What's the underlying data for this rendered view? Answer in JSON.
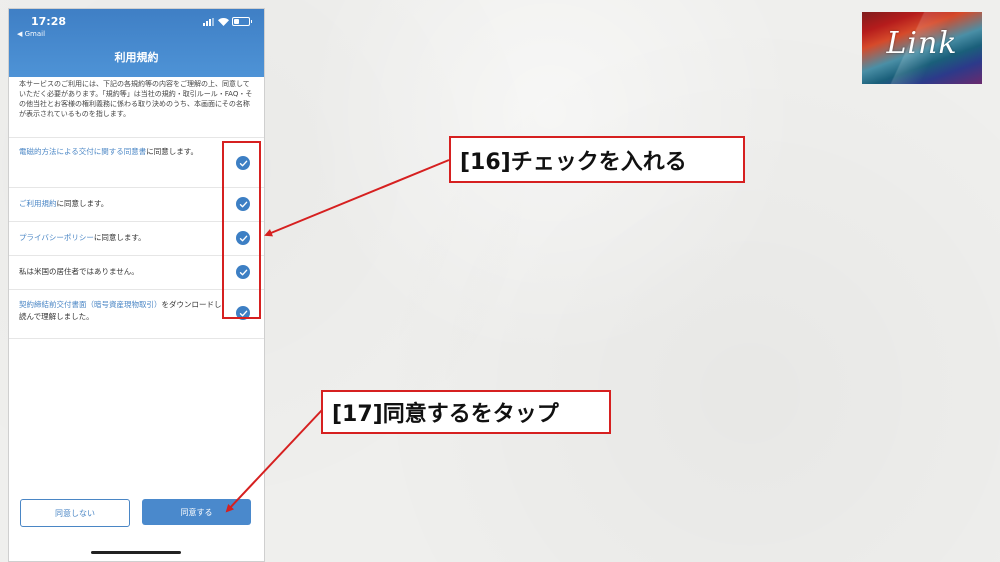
{
  "status_bar": {
    "time": "17:28",
    "back_app": "◀ Gmail"
  },
  "screen": {
    "title": "利用規約"
  },
  "intro": "本サービスのご利用には、下記の各規約等の内容をご理解の上、同意していただく必要があります。「規約等」は当社の規約・取引ルール・FAQ・その他当社とお客様の権利義務に係わる取り決めのうち、本画面にその名称が表示されているものを指します。",
  "agreements": [
    {
      "link": "電磁的方法による交付に関する同意書",
      "text": "に同意します。"
    },
    {
      "link": "ご利用規約",
      "text": "に同意します。"
    },
    {
      "link": "プライバシーポリシー",
      "text": "に同意します。"
    },
    {
      "link": "",
      "text": "私は米国の居住者ではありません。"
    },
    {
      "link": "契約締結前交付書面（暗号資産現物取引）",
      "text": "をダウンロードし読んで理解しました。"
    }
  ],
  "buttons": {
    "decline": "同意しない",
    "agree": "同意する"
  },
  "annotations": {
    "step16": "[16]チェックを入れる",
    "step17": "[17]同意するをタップ"
  },
  "logo": {
    "text": "Link"
  },
  "colors": {
    "header": "#4a89cc",
    "accent": "#3d7fc4",
    "annotation": "#d62020"
  }
}
